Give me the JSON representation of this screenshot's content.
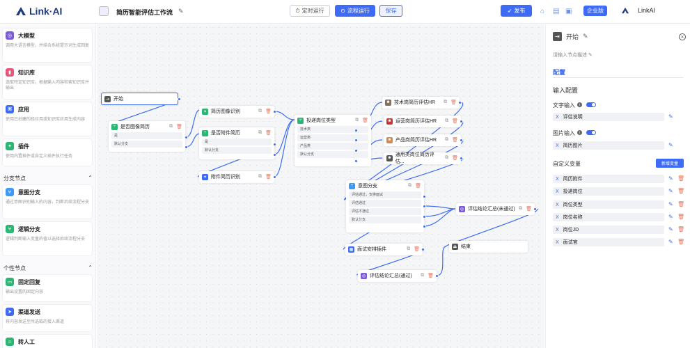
{
  "header": {
    "brand": "Link·AI",
    "title": "简历智能评估工作流",
    "timed_run": "定时运行",
    "flow_run": "流程运行",
    "save": "保存",
    "publish": "发布",
    "enterprise": "企业版",
    "account_name": "LinkAI"
  },
  "sidebar": {
    "cards_top": [
      {
        "title": "大模型",
        "desc": "调用大语言模型，并结合系统提示词生成回复",
        "color": "#7b5cd6",
        "icon": "brain-icon"
      },
      {
        "title": "知识库",
        "desc": "选取特定知识库，根据输入内容检索知识库并输出",
        "color": "#e8577a",
        "icon": "book-icon"
      },
      {
        "title": "应用",
        "desc": "使用已创建的轻应用或知识库应用生成内容",
        "color": "#3d6bf5",
        "icon": "app-icon"
      },
      {
        "title": "插件",
        "desc": "使用内置插件或自定义插件执行任务",
        "color": "#2bb673",
        "icon": "plugin-icon"
      }
    ],
    "section_branch": "分支节点",
    "cards_branch": [
      {
        "title": "意图分支",
        "desc": "通过意图识别输入的内容，判断后续流程分支",
        "color": "#3d9bf5",
        "icon": "branch-icon"
      },
      {
        "title": "逻辑分支",
        "desc": "逻辑判断输入变量的值以选择后续流程分支",
        "color": "#2bb673",
        "icon": "logic-icon"
      }
    ],
    "section_custom": "个性节点",
    "cards_custom": [
      {
        "title": "固定回复",
        "desc": "输出设置的固定内容",
        "color": "#2bb673",
        "icon": "reply-icon"
      },
      {
        "title": "渠道发送",
        "desc": "将内容发送至所选取的接入渠道",
        "color": "#3d6bf5",
        "icon": "send-icon"
      },
      {
        "title": "转人工",
        "desc": "",
        "color": "#2bb673",
        "icon": "person-icon"
      }
    ]
  },
  "nodes": {
    "start": {
      "title": "开始"
    },
    "has_image": {
      "title": "是否图像简历",
      "rows": [
        "是",
        "默认分支"
      ]
    },
    "image_ocr": {
      "title": "简历图像识别"
    },
    "has_attach": {
      "title": "是否附件简历",
      "rows": [
        "是",
        "默认分支"
      ]
    },
    "attach_ocr": {
      "title": "附件简历识别"
    },
    "job_type": {
      "title": "投递岗位类型",
      "rows": [
        "技术类",
        "运营类",
        "产品类",
        "默认分支"
      ]
    },
    "hr_tech": {
      "title": "技术岗简历评估HR"
    },
    "hr_ops": {
      "title": "运营岗简历评估HR"
    },
    "hr_prod": {
      "title": "产品岗简历评估HR"
    },
    "hr_general": {
      "title": "通用类岗位简历评估..."
    },
    "intent": {
      "title": "意图分支",
      "rows": [
        "评估通过，安排面试",
        "评估通过",
        "评估不通过",
        "默认分支"
      ]
    },
    "summary_fail": {
      "title": "评估结论汇总(未通过)"
    },
    "interview": {
      "title": "面试安排插件"
    },
    "end": {
      "title": "结束"
    },
    "summary_pass": {
      "title": "评估结论汇总(通过)"
    }
  },
  "panel": {
    "title": "开始",
    "desc_placeholder": "请输入节点描述",
    "tab": "配置",
    "input_config": "输入配置",
    "text_input": "文字输入",
    "text_field": "评估说明",
    "image_input": "图片输入",
    "image_field": "简历图片",
    "custom_vars": "自定义变量",
    "add_var": "新增变量",
    "vars": [
      "简历附件",
      "投递岗位",
      "岗位类型",
      "岗位名称",
      "岗位JD",
      "面试官"
    ]
  },
  "colors": {
    "accent": "#3d6bf5",
    "danger": "#e8735a"
  }
}
